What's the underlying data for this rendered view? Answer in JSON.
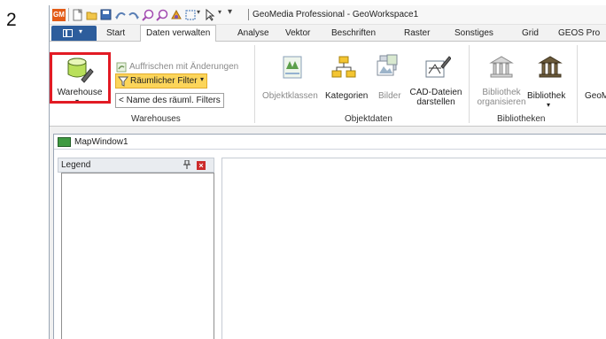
{
  "step": "2",
  "app": {
    "logo": "GM",
    "title": "GeoMedia Professional - GeoWorkspace1"
  },
  "tabs": [
    {
      "label": "Start"
    },
    {
      "label": "Daten verwalten"
    },
    {
      "label": "Analyse"
    },
    {
      "label": "Vektor"
    },
    {
      "label": "Beschriften"
    },
    {
      "label": "Raster"
    },
    {
      "label": "Sonstiges"
    },
    {
      "label": "Grid"
    },
    {
      "label": "GEOS Pro"
    }
  ],
  "ribbon": {
    "warehouses": {
      "warehouse_label": "Warehouse",
      "refresh_label": "Auffrischen mit Änderungen",
      "spatial_filter_label": "Räumlicher Filter",
      "filter_name_label": "< Name des räuml. Filters",
      "group_label": "Warehouses"
    },
    "objektdaten": {
      "objektklassen": "Objektklassen",
      "kategorien": "Kategorien",
      "bilder": "Bilder",
      "cad_line1": "CAD-Dateien",
      "cad_line2": "darstellen",
      "group_label": "Objektdaten"
    },
    "bibliotheken": {
      "bib_org_line1": "Bibliothek",
      "bib_org_line2": "organisieren",
      "bibliothek": "Bibliothek",
      "group_label": "Bibliotheken"
    },
    "geom_partial": "GeoM"
  },
  "map_window": {
    "title": "MapWindow1",
    "legend_title": "Legend",
    "pin": "ᵖ",
    "close": "×"
  },
  "colors": {
    "highlight": "#e21b24",
    "file_tab": "#2d5d9c",
    "filter_button": "#fcd55a",
    "logo": "#e35b17"
  }
}
